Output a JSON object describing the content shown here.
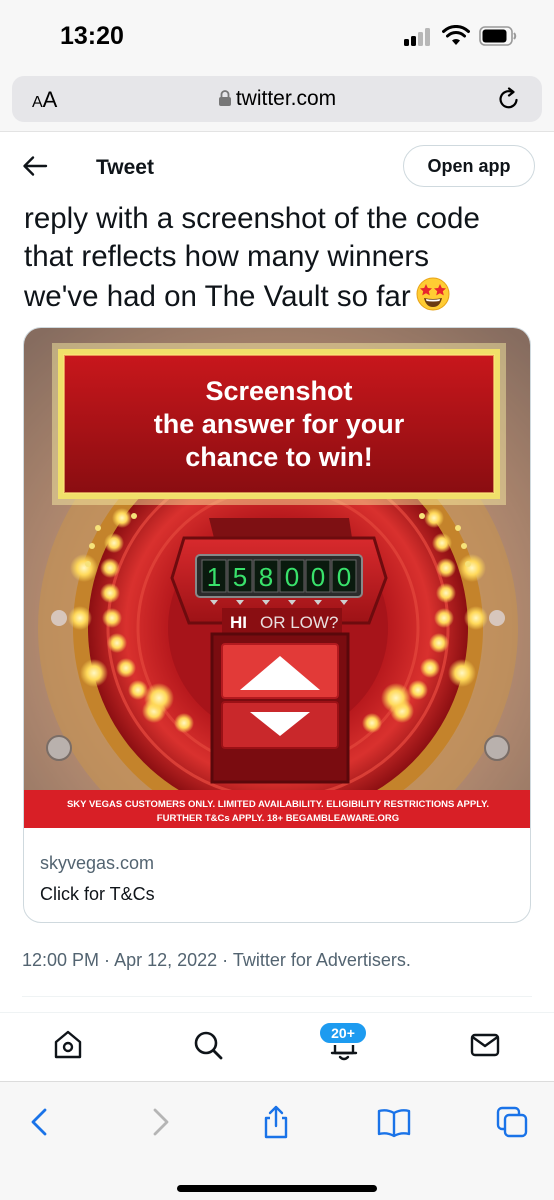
{
  "status_bar": {
    "time": "13:20"
  },
  "browser": {
    "text_size_label_small": "A",
    "text_size_label_large": "A",
    "url": "twitter.com"
  },
  "tweet_header": {
    "title": "Tweet",
    "open_app_label": "Open app"
  },
  "tweet": {
    "text_line1": "reply with a screenshot of the code",
    "text_line2": "that reflects how many winners",
    "text_line3": "we've had on The Vault so far",
    "emoji": "star-struck-emoji"
  },
  "card": {
    "headline_line1": "Screenshot",
    "headline_line2": "the answer for your",
    "headline_line3": "chance to win!",
    "counter_digits": [
      "1",
      "5",
      "8",
      "0",
      "0",
      "0"
    ],
    "hi_label": "HI",
    "or_low_label": "OR LOW?",
    "disclaimer_line1": "SKY VEGAS CUSTOMERS ONLY. LIMITED AVAILABILITY. ELIGIBILITY RESTRICTIONS APPLY.",
    "disclaimer_line2": "FURTHER T&Cs APPLY. 18+ BEGAMBLEAWARE.ORG",
    "domain": "skyvegas.com",
    "title": "Click for T&Cs"
  },
  "meta": {
    "time": "12:00 PM",
    "separator": " · ",
    "date": "Apr 12, 2022",
    "source": "Twitter for Advertisers."
  },
  "tab_bar": {
    "items": [
      "home-icon",
      "search-icon",
      "notifications-icon",
      "messages-icon"
    ],
    "notification_badge": "20+"
  },
  "safari_toolbar": {
    "items": [
      "back-icon",
      "forward-icon",
      "share-icon",
      "bookmarks-icon",
      "tabs-icon"
    ]
  },
  "colors": {
    "accent": "#1d9bf0",
    "ad_red": "#c41a20",
    "ad_gold": "#f2d23a",
    "counter_green": "#39e26b",
    "text_primary": "#0f1419",
    "text_secondary": "#536471"
  }
}
